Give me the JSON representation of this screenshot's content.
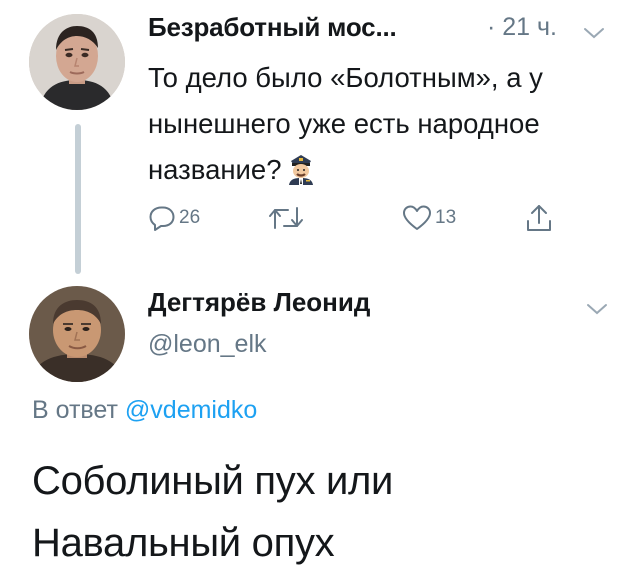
{
  "tweet1": {
    "author_name": "Безработный мос...",
    "time": "· 21 ч.",
    "text": "То дело было «Болотным», а у нынешнего уже есть народное название?",
    "emoji": "pilot-man-emoji",
    "actions": {
      "reply_count": "26",
      "retweet_count": "",
      "like_count": "13"
    }
  },
  "tweet2": {
    "author_name": "Дегтярёв Леонид",
    "handle": "@leon_elk",
    "reply_prefix": "В ответ",
    "reply_mention": "@vdemidko",
    "text": "Соболиный пух или Навальный опух"
  },
  "colors": {
    "text": "#14171a",
    "secondary": "#657786",
    "link": "#1da1f2",
    "thread_line": "#c4cfd6"
  },
  "icons": [
    "reply-icon",
    "retweet-icon",
    "like-icon",
    "share-icon",
    "chevron-down-icon"
  ]
}
